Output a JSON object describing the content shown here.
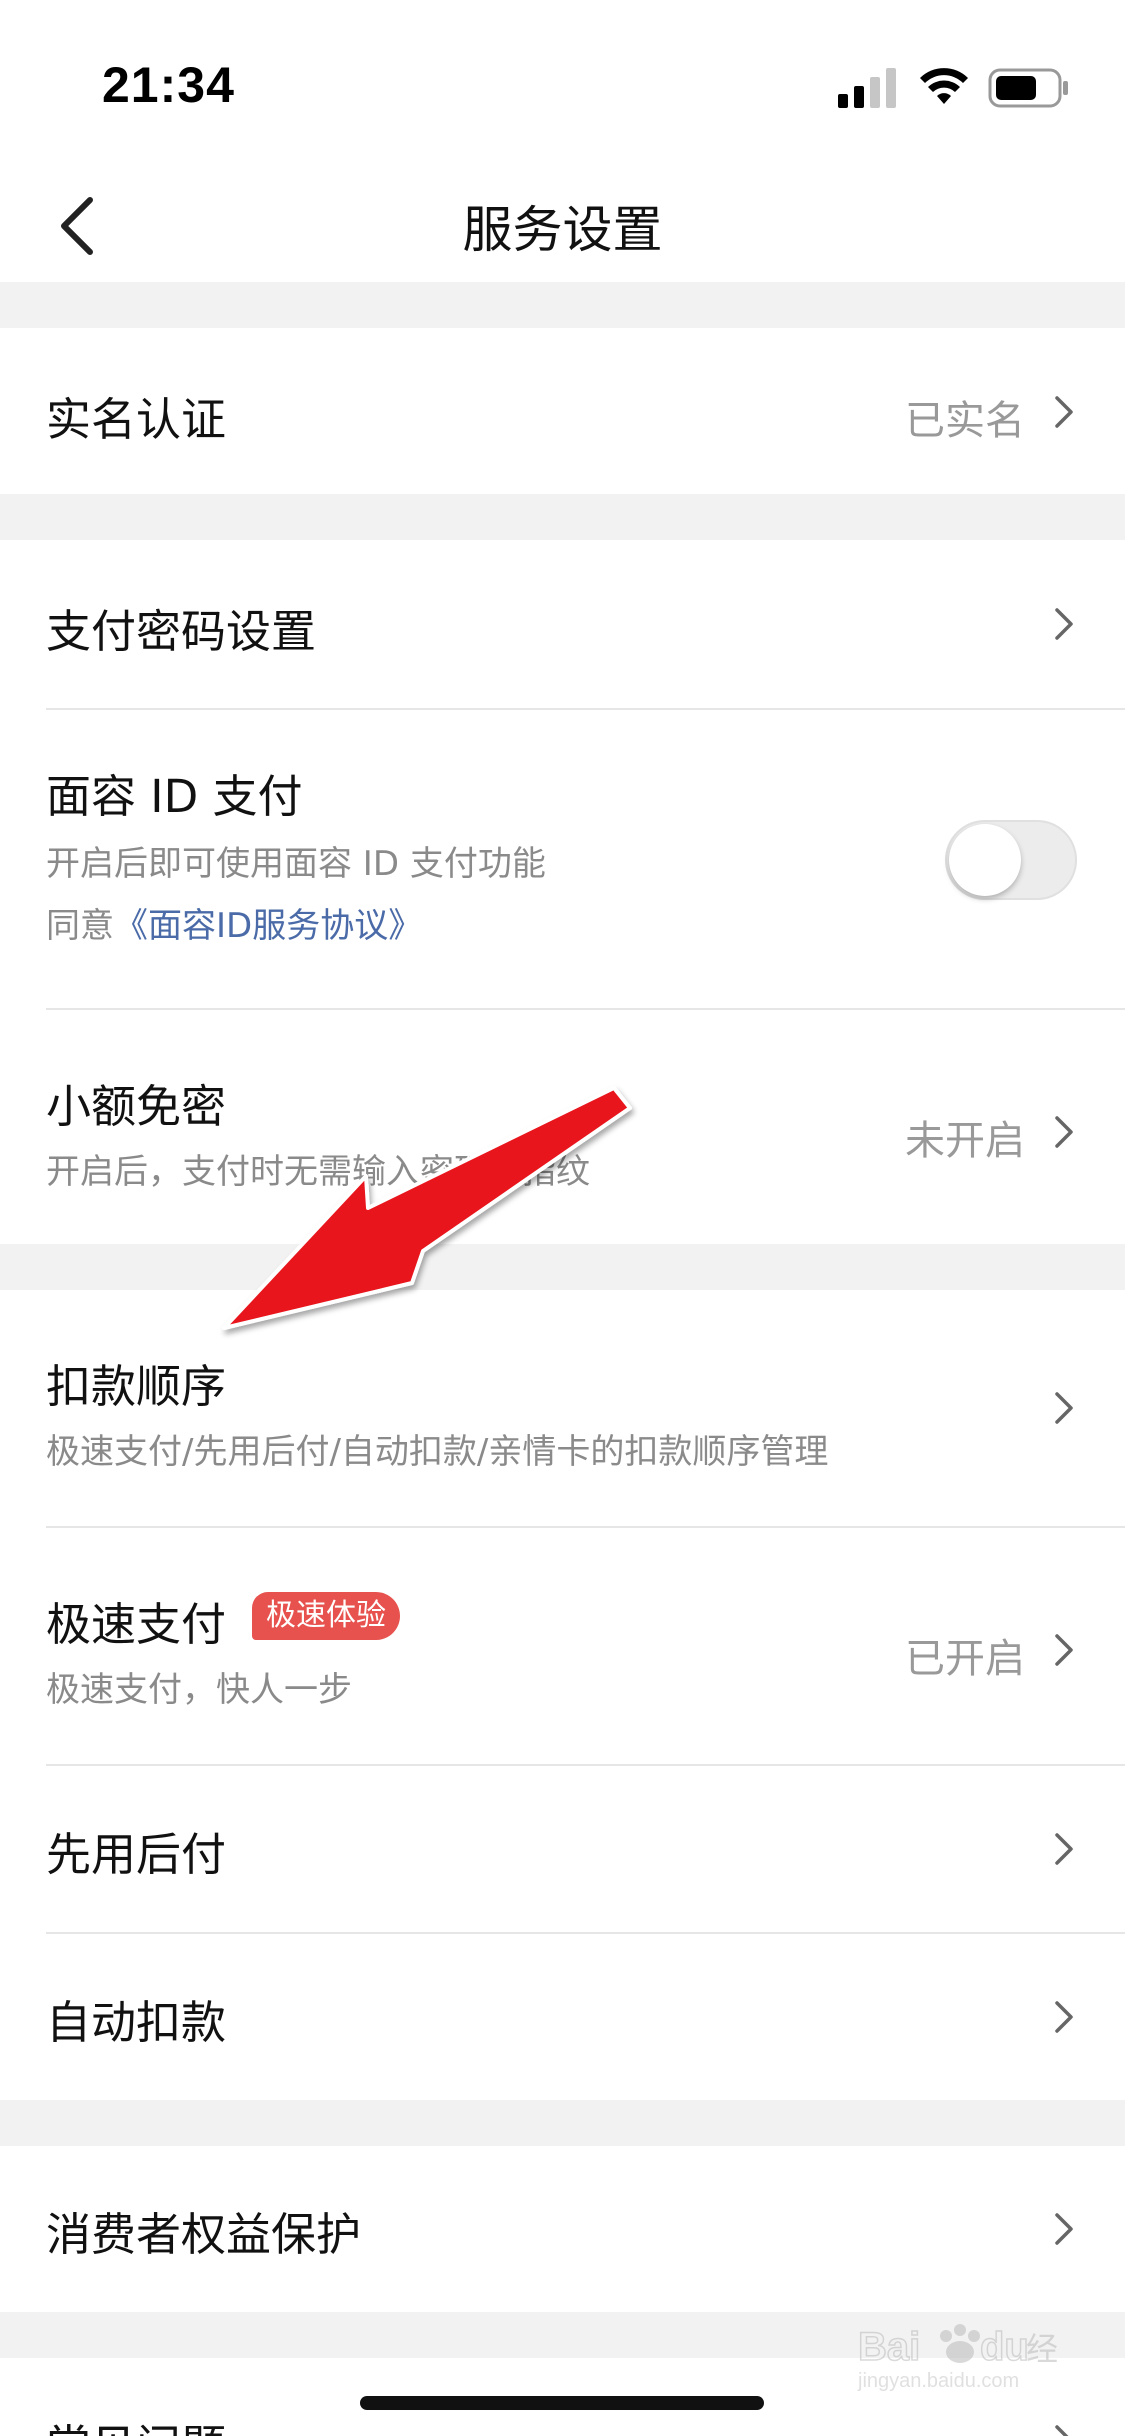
{
  "status_bar": {
    "time": "21:34"
  },
  "nav": {
    "title": "服务设置"
  },
  "sections": {
    "real_name": {
      "title": "实名认证",
      "value": "已实名"
    },
    "pay_password": {
      "title": "支付密码设置"
    },
    "face_id": {
      "title": "面容 ID 支付",
      "subtitle": "开启后即可使用面容 ID 支付功能",
      "agree_prefix": "同意",
      "agree_link": "《面容ID服务协议》",
      "toggle_on": false
    },
    "small_free": {
      "title": "小额免密",
      "subtitle": "开启后，支付时无需输入密码或指纹",
      "value": "未开启"
    },
    "deduct_order": {
      "title": "扣款顺序",
      "subtitle": "极速支付/先用后付/自动扣款/亲情卡的扣款顺序管理"
    },
    "fast_pay": {
      "title": "极速支付",
      "badge": "极速体验",
      "subtitle": "极速支付，快人一步",
      "value": "已开启"
    },
    "pay_later": {
      "title": "先用后付"
    },
    "auto_deduct": {
      "title": "自动扣款"
    },
    "consumer_rights": {
      "title": "消费者权益保护"
    },
    "faq": {
      "title": "常见问题"
    }
  },
  "watermark": {
    "url": "jingyan.baidu.com"
  },
  "colors": {
    "link": "#4a6ba8",
    "badge": "#e7524e",
    "annotation_arrow": "#e8141b",
    "background": "#f2f2f2"
  },
  "icons": [
    "back-chevron-icon",
    "chevron-right-icon",
    "signal-icon",
    "wifi-icon",
    "battery-icon"
  ]
}
